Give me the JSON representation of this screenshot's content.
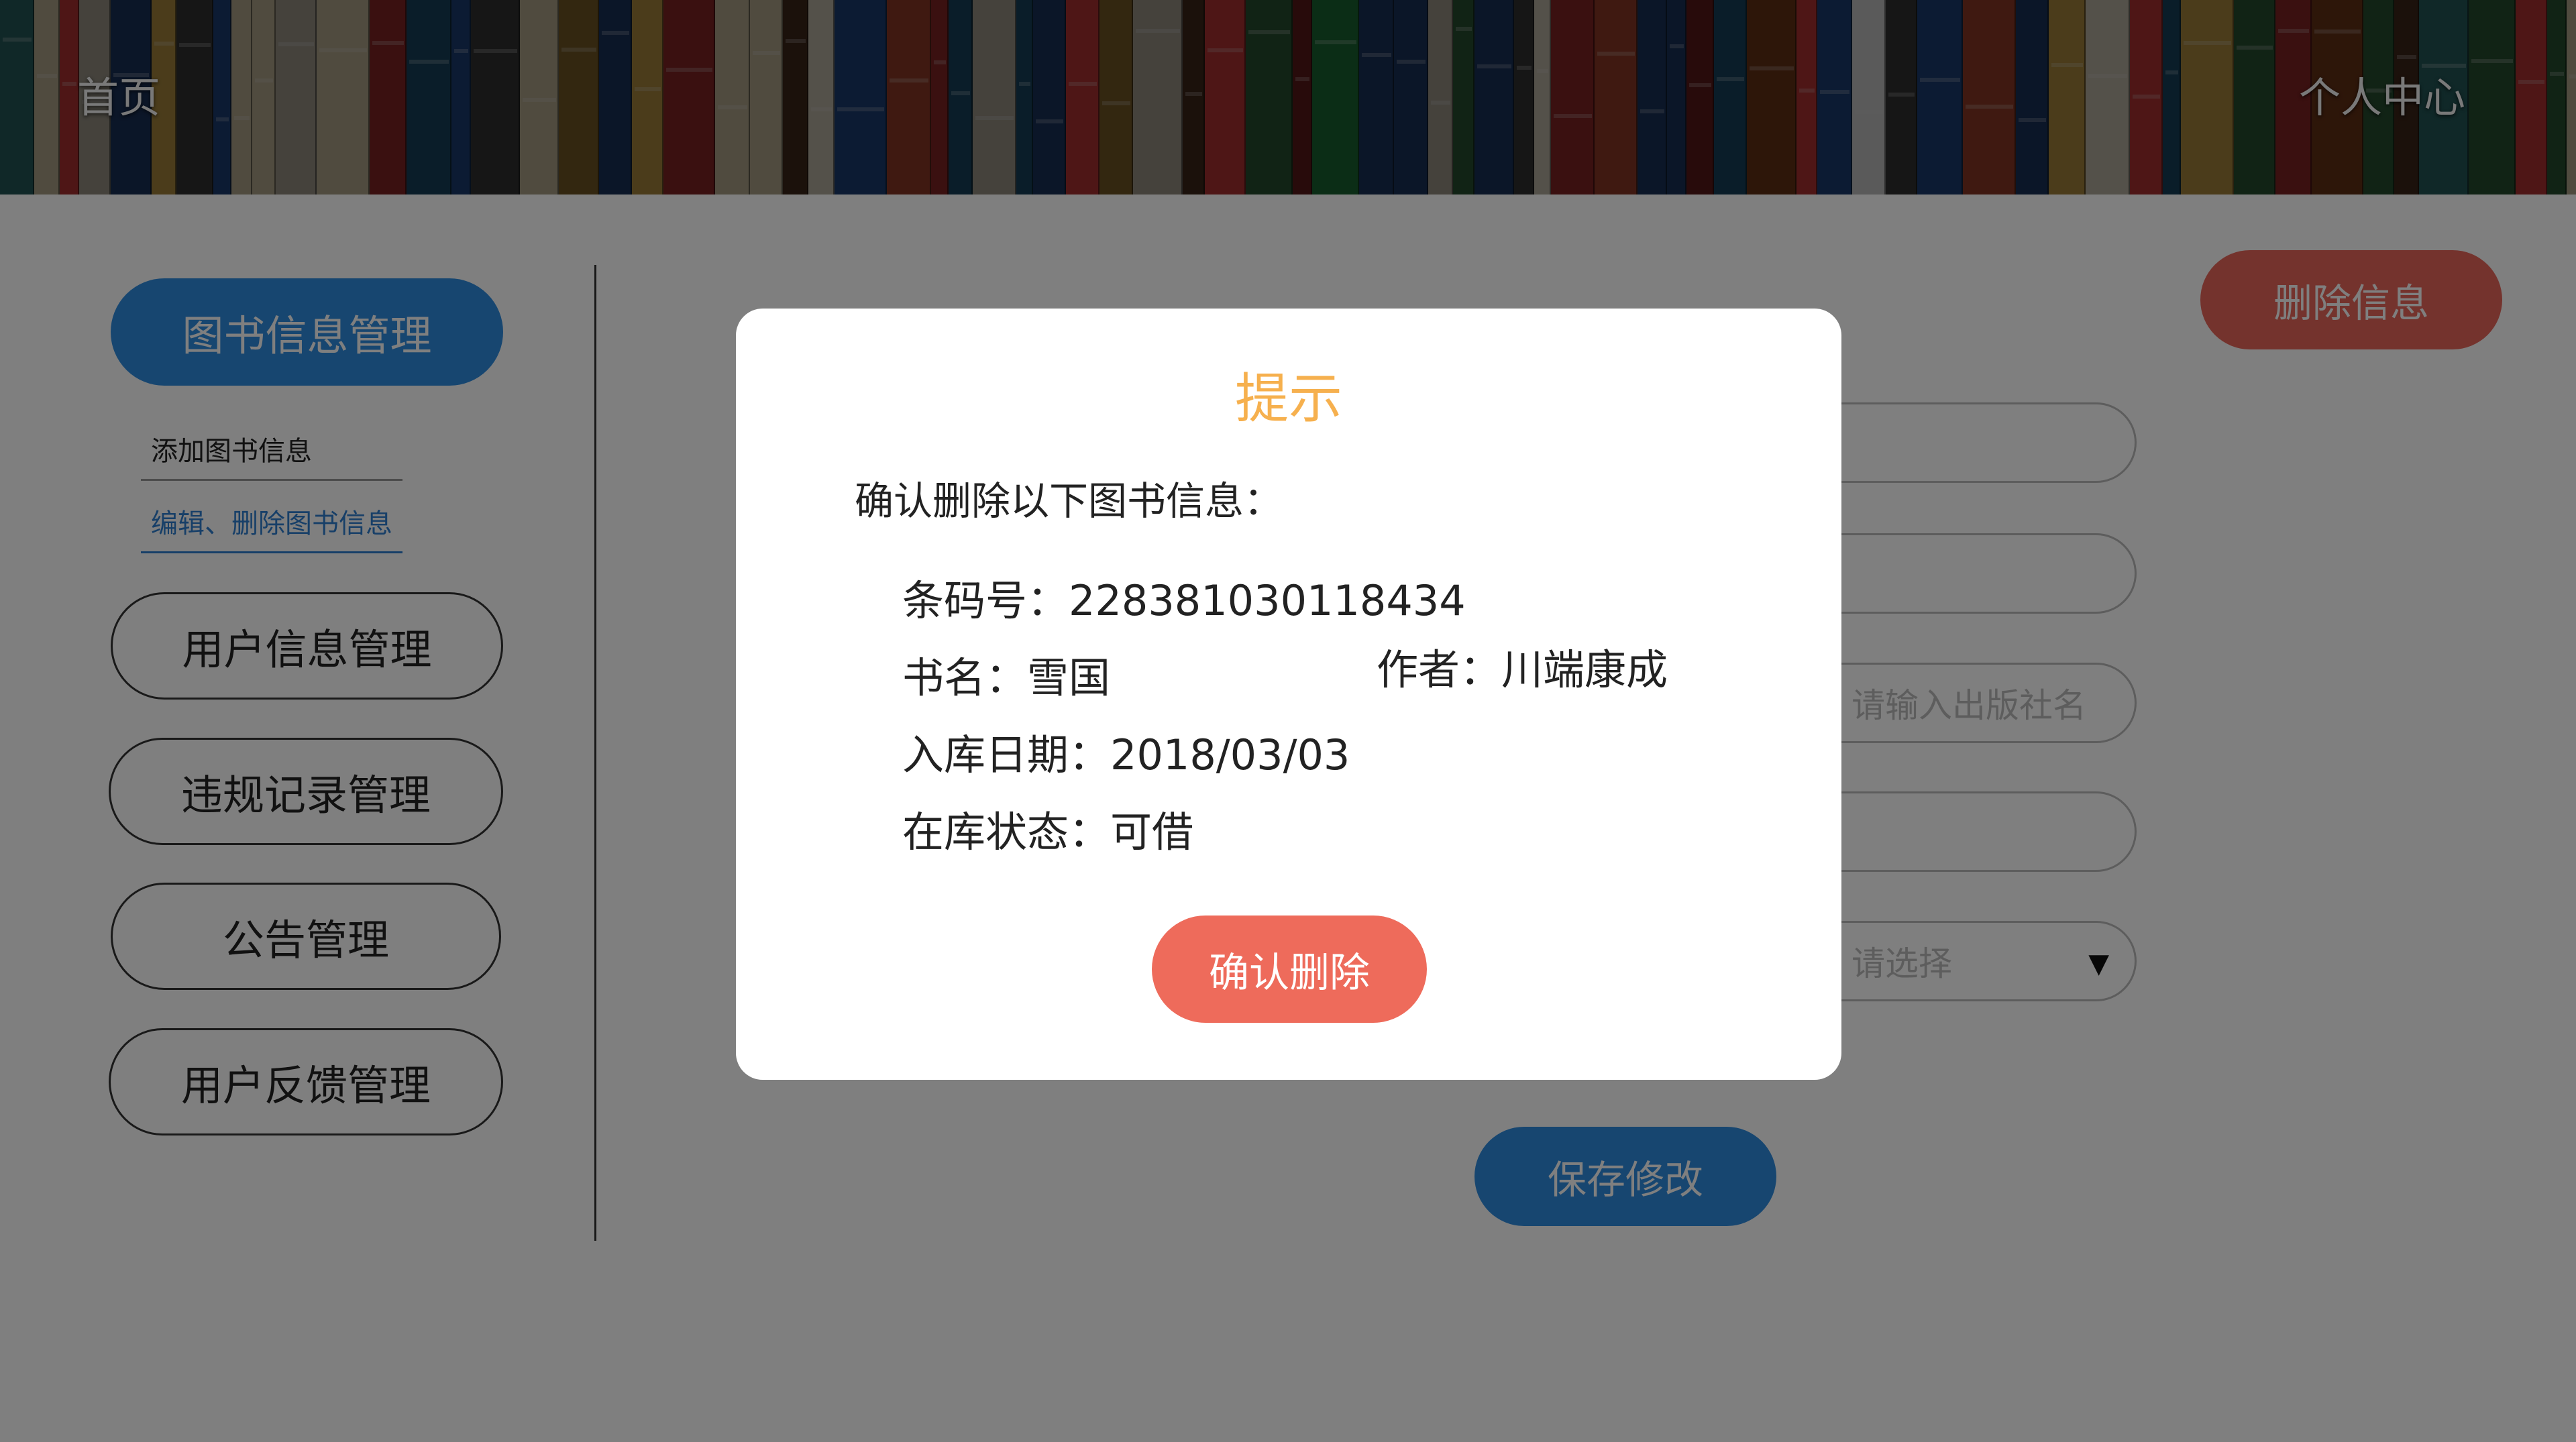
{
  "header": {
    "home_label": "首页",
    "user_center_label": "个人中心"
  },
  "sidebar": {
    "items": [
      {
        "label": "图书信息管理",
        "active": true
      },
      {
        "label": "用户信息管理",
        "active": false
      },
      {
        "label": "违规记录管理",
        "active": false
      },
      {
        "label": "公告管理",
        "active": false
      },
      {
        "label": "用户反馈管理",
        "active": false
      }
    ],
    "sub_items": [
      {
        "label": "添加图书信息",
        "active": false
      },
      {
        "label": "编辑、删除图书信息",
        "active": true
      }
    ]
  },
  "main": {
    "delete_info_label": "删除信息",
    "publisher_placeholder": "请输入出版社名",
    "select_placeholder": "请选择",
    "save_label": "保存修改"
  },
  "modal": {
    "title": "提示",
    "question": "确认删除以下图书信息：",
    "barcode": "条码号：228381030118434",
    "book_name": "书名：雪国",
    "author": "作者：川端康成",
    "storage_date": "入库日期：2018/03/03",
    "status": "在库状态：可借",
    "confirm_label": "确认删除"
  },
  "colors": {
    "primary_blue": "#2f8de0",
    "danger_red": "#ee6b5b",
    "title_orange": "#f6b04e"
  }
}
